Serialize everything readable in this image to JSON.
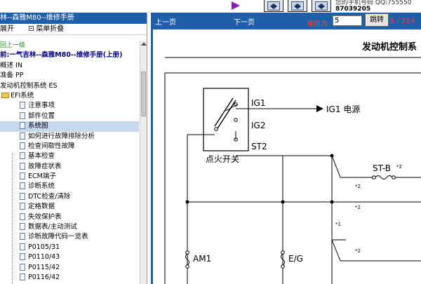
{
  "toolbar": {
    "contact_line1": "您的手机号码 QQ:755550",
    "contact_qq": "QQ:755550",
    "contact_line2": "87039205"
  },
  "left_pane": {
    "title": "林--森雅M80--维修手册",
    "expand_label": "展开",
    "collapse_label": "菜单折叠",
    "back_link": "回上一级",
    "book_title": "前:一气吉林--森雅M80--维修手册(上册)",
    "tree": [
      {
        "label": "概述 IN",
        "level": 1
      },
      {
        "label": "准备 PP",
        "level": 1
      },
      {
        "label": "发动机控制系统 ES",
        "level": 1
      },
      {
        "label": "EFI系统",
        "level": 2
      }
    ],
    "leaves": [
      "注意事项",
      "部件位置",
      "系统图",
      "如何进行故障排除分析",
      "检查间歇性故障",
      "基本检查",
      "故障症状表",
      "ECM端子",
      "诊断系统",
      "DTC检查/清除",
      "定格数据",
      "失效保护表",
      "数据表/主动测试",
      "诊断故障代码一览表",
      "P0105/31",
      "P0110/43",
      "P0115/42",
      "P0116/42"
    ],
    "selected_leaf_index": 2
  },
  "right_pane": {
    "prev_label": "上一页",
    "next_label": "下一页",
    "current_label": "当前为",
    "page_value": "5",
    "go_label": "跳转",
    "page_count": "5 / 214"
  },
  "diagram": {
    "section_title": "发动机控制系",
    "switch_name": "点火开关",
    "terminals": [
      "IG1",
      "IG2",
      "ST2"
    ],
    "ig1_target": "IG1 电源",
    "fuse_stb": "ST-B",
    "fuse_am1": "AM1",
    "fuse_eg": "E/G",
    "note_2": "*2",
    "note_1": "*1"
  }
}
